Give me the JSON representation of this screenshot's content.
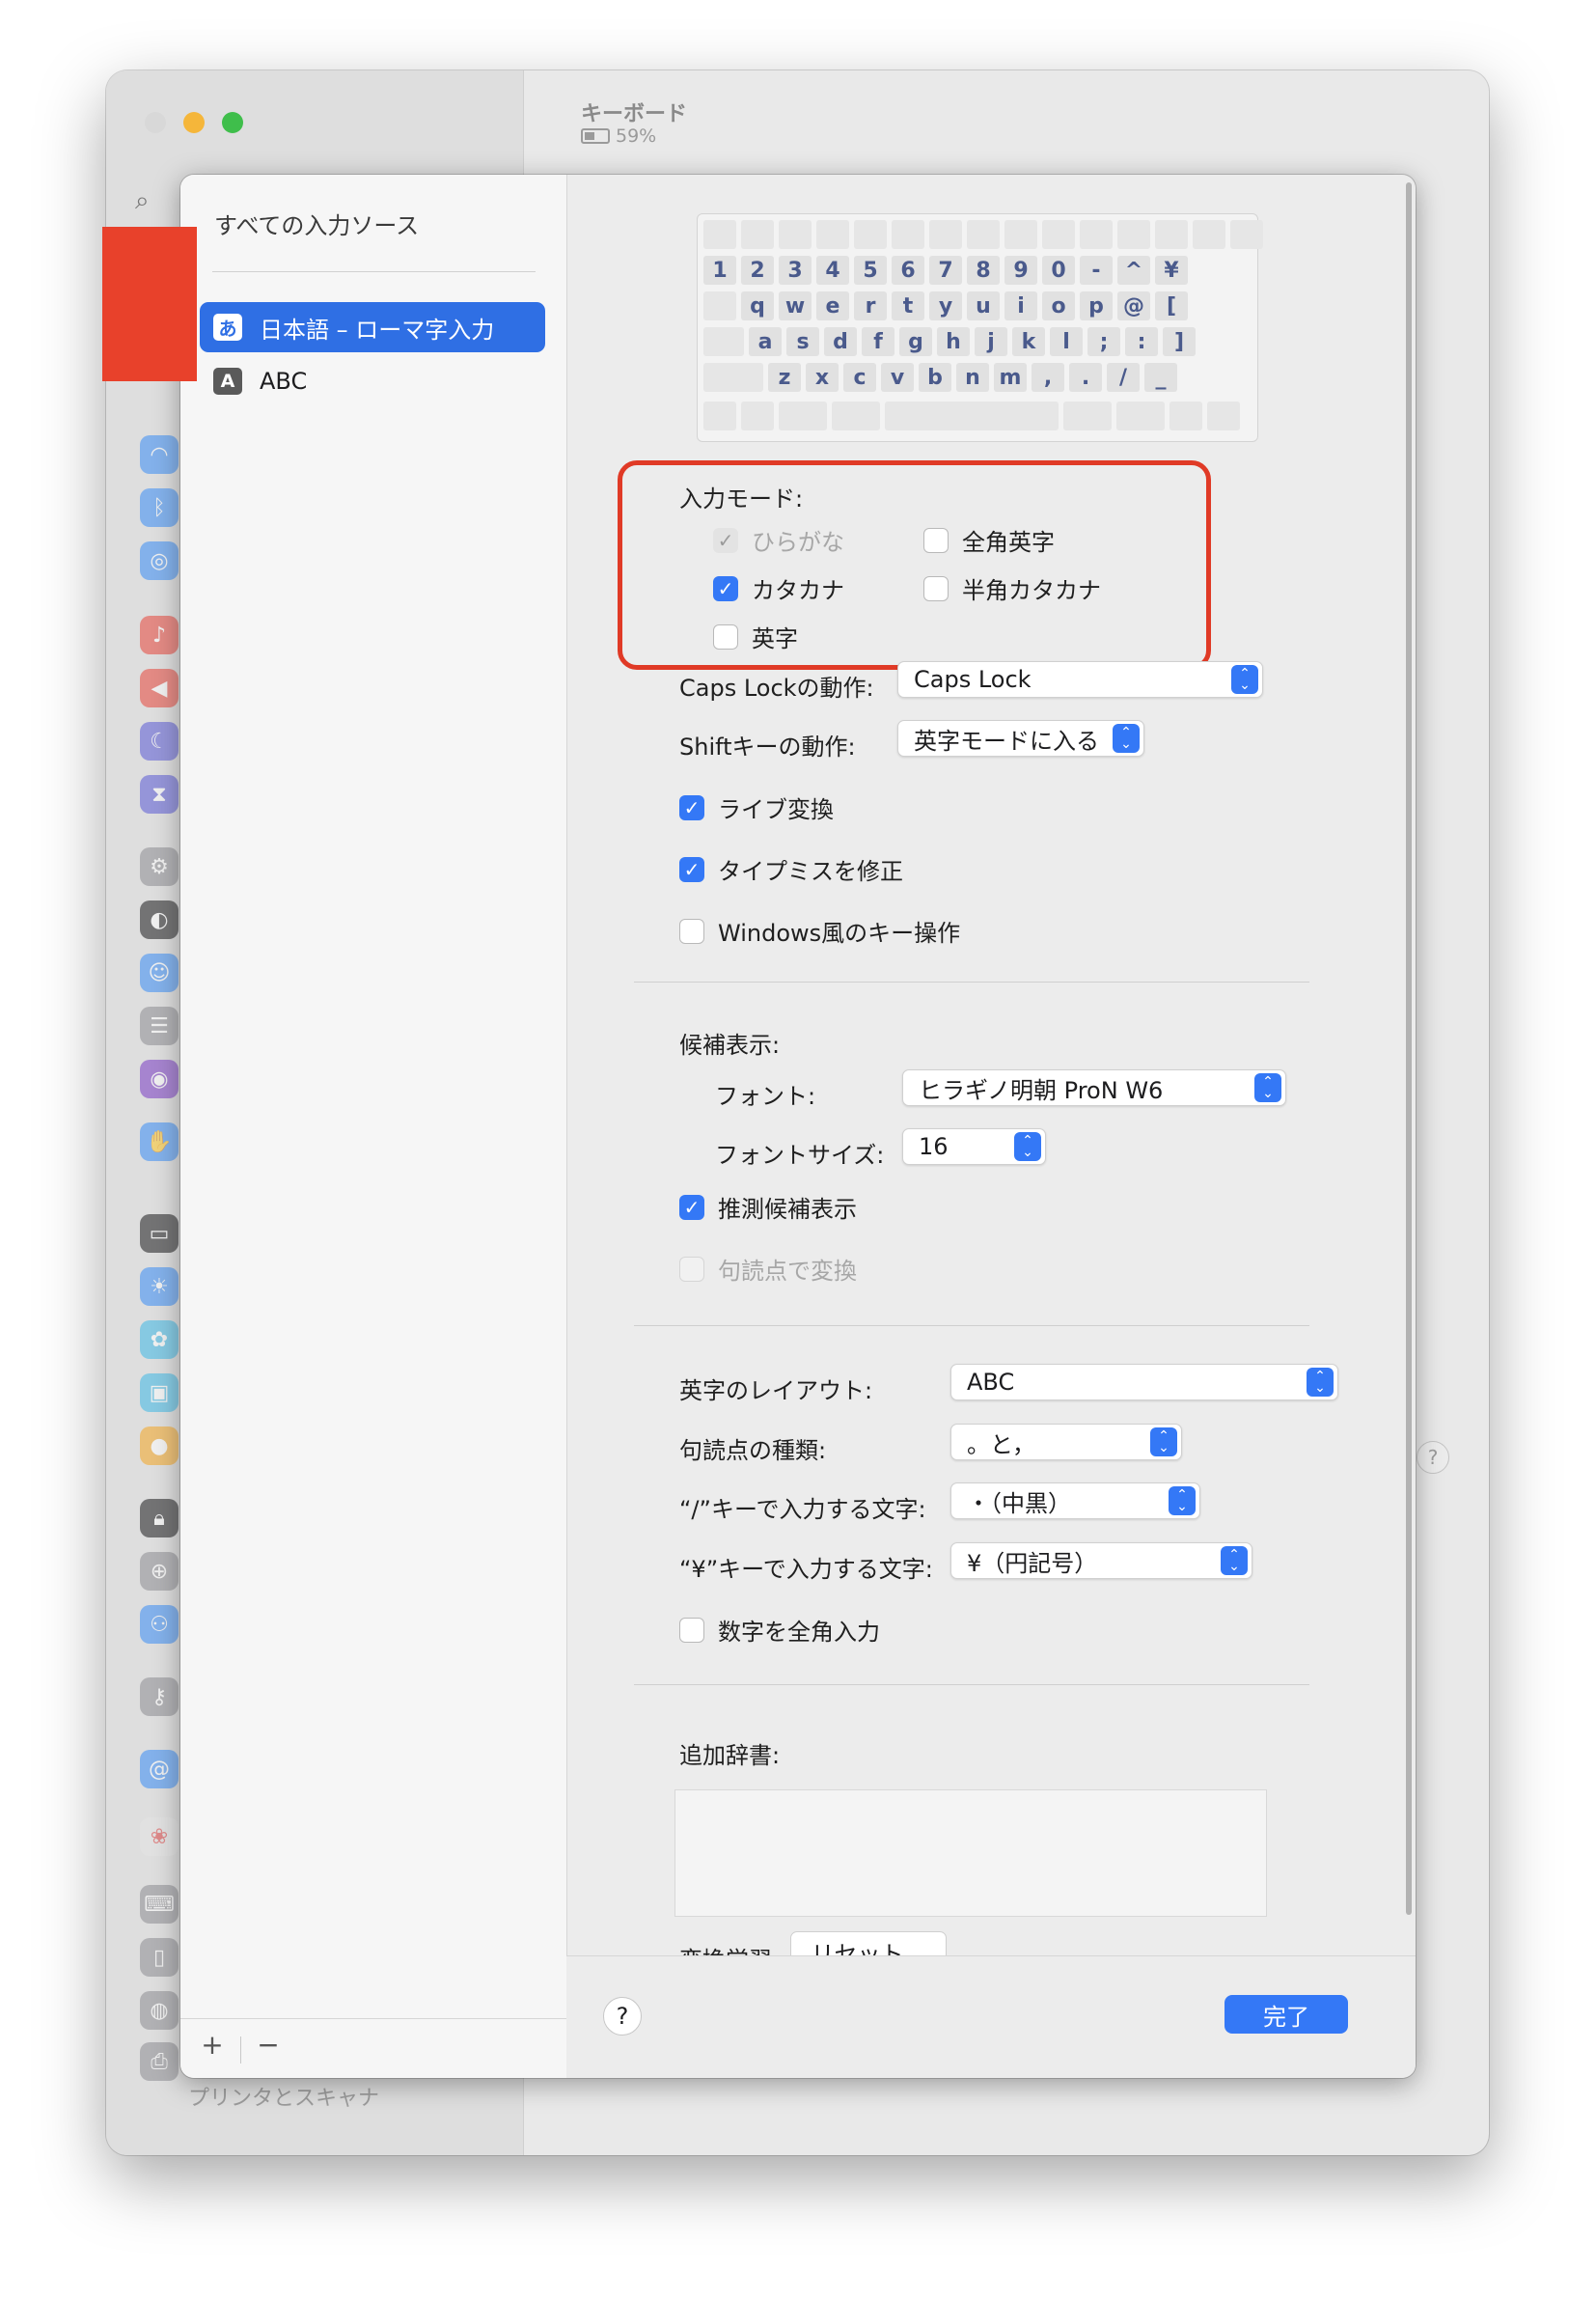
{
  "background_window": {
    "title": "キーボード",
    "battery": "59%",
    "last_sidebar_item": "プリンタとスキャナ",
    "help": "?",
    "traffic_colors": [
      "#d8d8d8",
      "#f5b63a",
      "#3fbe4b"
    ]
  },
  "sheet": {
    "left_pane": {
      "header": "すべての入力ソース",
      "sources": [
        {
          "badge": "あ",
          "label": "日本語 – ローマ字入力",
          "selected": true
        },
        {
          "badge": "A",
          "label": "ABC",
          "selected": false
        }
      ],
      "add": "+",
      "remove": "−"
    },
    "keyboard": {
      "row1": [
        "1",
        "2",
        "3",
        "4",
        "5",
        "6",
        "7",
        "8",
        "9",
        "0",
        "-",
        "^",
        "¥"
      ],
      "row2": [
        "q",
        "w",
        "e",
        "r",
        "t",
        "y",
        "u",
        "i",
        "o",
        "p",
        "@",
        "["
      ],
      "row3": [
        "a",
        "s",
        "d",
        "f",
        "g",
        "h",
        "j",
        "k",
        "l",
        ";",
        ":",
        "]"
      ],
      "row4": [
        "z",
        "x",
        "c",
        "v",
        "b",
        "n",
        "m",
        ",",
        ".",
        "/",
        "_"
      ]
    },
    "input_mode": {
      "label": "入力モード:",
      "hiragana": {
        "label": "ひらがな",
        "checked": true,
        "disabled": true
      },
      "zenkaku_eiji": {
        "label": "全角英字",
        "checked": false
      },
      "katakana": {
        "label": "カタカナ",
        "checked": true
      },
      "hankaku_katakana": {
        "label": "半角カタカナ",
        "checked": false
      },
      "eiji": {
        "label": "英字",
        "checked": false
      }
    },
    "caps_lock": {
      "label": "Caps Lockの動作:",
      "value": "Caps Lock"
    },
    "shift": {
      "label": "Shiftキーの動作:",
      "value": "英字モードに入る"
    },
    "live_conversion": {
      "label": "ライブ変換",
      "checked": true
    },
    "typo_fix": {
      "label": "タイプミスを修正",
      "checked": true
    },
    "windows_keys": {
      "label": "Windows風のキー操作",
      "checked": false
    },
    "candidates": {
      "label": "候補表示:",
      "font_label": "フォント:",
      "font_value": "ヒラギノ明朝 ProN W6",
      "size_label": "フォントサイズ:",
      "size_value": "16",
      "predictive": {
        "label": "推測候補表示",
        "checked": true
      },
      "punct_convert": {
        "label": "句読点で変換",
        "checked": false,
        "disabled": true
      }
    },
    "layout": {
      "label": "英字のレイアウト:",
      "value": "ABC"
    },
    "punct_type": {
      "label": "句読点の種類:",
      "value": "。と，"
    },
    "slash_key": {
      "label": "“/”キーで入力する文字:",
      "value": "・（中黒）"
    },
    "yen_key": {
      "label": "“¥”キーで入力する文字:",
      "value": "¥（円記号）"
    },
    "fullwidth_numbers": {
      "label": "数字を全角入力",
      "checked": false
    },
    "dictionary": {
      "label": "追加辞書:"
    },
    "learning": {
      "label": "変換学習:",
      "reset": "リセット..."
    },
    "help": "?",
    "done": "完了",
    "accent": "#3478f6",
    "highlight_box_color": "#e03a26"
  }
}
